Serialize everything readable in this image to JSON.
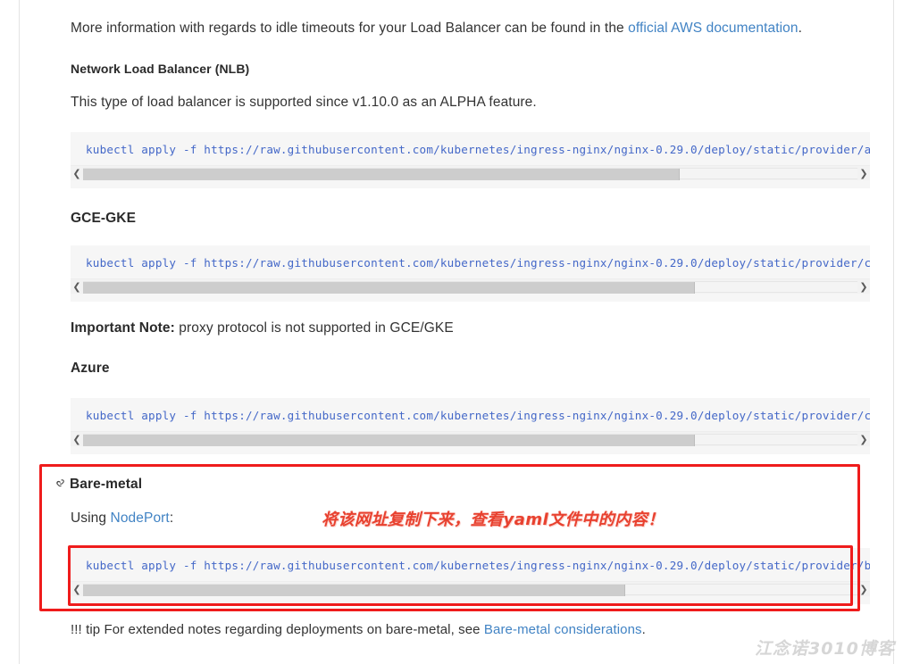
{
  "page": {
    "intro_paragraph": {
      "before_link": "More information with regards to idle timeouts for your Load Balancer can be found in the ",
      "link_text": "official AWS documentation",
      "after_link": "."
    },
    "sections": [
      {
        "heading": "Network Load Balancer (NLB)",
        "paragraph": "This type of load balancer is supported since v1.10.0 as an ALPHA feature.",
        "code": "kubectl apply -f https://raw.githubusercontent.com/kubernetes/ingress-nginx/nginx-0.29.0/deploy/static/provider/aws/service-nlb.yaml",
        "scroll_thumb_percent": "77"
      },
      {
        "heading": "GCE-GKE",
        "code": "kubectl apply -f https://raw.githubusercontent.com/kubernetes/ingress-nginx/nginx-0.29.0/deploy/static/provider/cloud-generic.yaml",
        "scroll_thumb_percent": "79"
      },
      {
        "heading": "Azure",
        "code": "kubectl apply -f https://raw.githubusercontent.com/kubernetes/ingress-nginx/nginx-0.29.0/deploy/static/provider/cloud-generic.yaml",
        "scroll_thumb_percent": "79"
      }
    ],
    "important_note": {
      "label": "Important Note:",
      "text": " proxy protocol is not supported in GCE/GKE"
    },
    "bare_metal": {
      "heading": "Bare-metal",
      "anchor_icon": "link-icon",
      "using_prefix": "Using ",
      "using_link": "NodePort",
      "using_suffix": ":",
      "code": "kubectl apply -f https://raw.githubusercontent.com/kubernetes/ingress-nginx/nginx-0.29.0/deploy/static/provider/baremetal/service-nodeport.yaml",
      "scroll_thumb_percent": "70"
    },
    "tip": {
      "before_link": "!!! tip For extended notes regarding deployments on bare-metal, see ",
      "link_text": "Bare-metal considerations",
      "after_link": "."
    },
    "annotation": {
      "chinese_note": "将该网址复制下来，查看yaml文件中的内容！"
    },
    "watermark": "江念诺3010博客",
    "colors": {
      "link": "#4183c4",
      "code_text": "#4468c8",
      "code_background": "#f6f6f6",
      "annotation_red": "#ef1c1c",
      "body_text": "#333333"
    }
  }
}
